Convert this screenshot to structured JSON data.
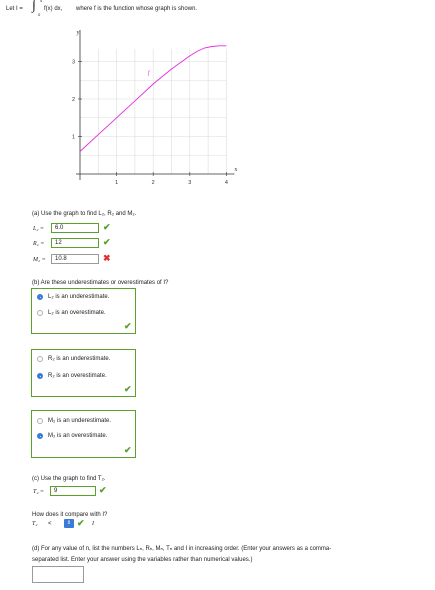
{
  "intro": {
    "let_text": "Let I =",
    "integral_upper": "4",
    "integral_lower": "0",
    "integrand": "f(x) dx,",
    "rest": "where f is the function whose graph is shown."
  },
  "chart_data": {
    "type": "line",
    "xlabel": "x",
    "ylabel": "y",
    "xlim": [
      0,
      4
    ],
    "ylim": [
      0,
      3.5
    ],
    "xticks": [
      "1",
      "2",
      "3",
      "4"
    ],
    "yticks": [
      "1",
      "2",
      "3"
    ],
    "grid": true,
    "grid_x": [
      0.5,
      1,
      1.5,
      2,
      2.5,
      3,
      3.5,
      4
    ],
    "grid_y": [
      0.5,
      1,
      1.5,
      2,
      2.5,
      3
    ],
    "series": [
      {
        "name": "f",
        "color": "#e02de0",
        "x": [
          0,
          0.5,
          1,
          1.5,
          2,
          2.5,
          3,
          3.2,
          3.4,
          3.6,
          3.8,
          4
        ],
        "y": [
          0.6,
          1.05,
          1.5,
          1.95,
          2.4,
          2.8,
          3.15,
          3.27,
          3.36,
          3.4,
          3.42,
          3.42
        ]
      }
    ],
    "annotation": "f"
  },
  "part_a": {
    "question": "(a) Use the graph to find L₂, R₂ and M₂.",
    "rows": [
      {
        "label": "L₂ =",
        "value": "6.0",
        "status": "correct"
      },
      {
        "label": "R₂ =",
        "value": "12",
        "status": "correct"
      },
      {
        "label": "M₂ =",
        "value": "10.8",
        "status": "incorrect"
      }
    ]
  },
  "part_b": {
    "question": "(b) Are these underestimates or overestimates of I?",
    "groups": [
      {
        "options": [
          "L₂ is an underestimate.",
          "L₂ is an overestimate."
        ],
        "selected": 0
      },
      {
        "options": [
          "R₂ is an underestimate.",
          "R₂ is an overestimate."
        ],
        "selected": 1
      },
      {
        "options": [
          "M₂ is an underestimate.",
          "M₂ is an overestimate."
        ],
        "selected": 1
      }
    ]
  },
  "part_c": {
    "question": "(c) Use the graph to find T₂.",
    "label": "T₂ =",
    "value": "9",
    "compare_question": "How does it compare with I?",
    "compare_left": "T₂",
    "compare_value": "<",
    "compare_right": "I"
  },
  "part_d": {
    "question_line1": "(d) For any value of n, list the numbers Lₙ, Rₙ, Mₙ, Tₙ and I in increasing order. (Enter your answers as a comma-",
    "question_line2": "separated list. Enter your answer using the variables rather than numerical values.)",
    "value": ""
  },
  "colors": {
    "correct": "#5aa02c",
    "incorrect": "#e03030",
    "radio_selected": "#3a7bd5",
    "curve": "#e02de0"
  },
  "icons": {
    "check": "✔",
    "cross": "✖",
    "spinner": "⇕"
  }
}
